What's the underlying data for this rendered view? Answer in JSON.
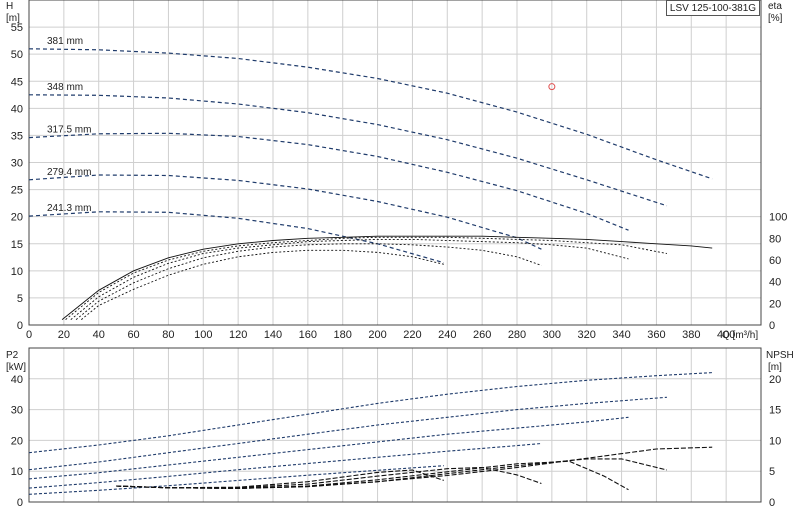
{
  "colors": {
    "curve_dark": "#1f3b6b",
    "curve_black": "#111111",
    "grid": "#cfcfcf",
    "frame": "#444444",
    "point": "#e05050"
  },
  "title": "LSV 125-100-381G",
  "chart_data": [
    {
      "type": "line",
      "name": "head",
      "ylabel_left_top": "H",
      "ylabel_left_unit": "[m]",
      "ylabel_right_top": "eta",
      "ylabel_right_unit": "[%]",
      "xlabel": "Q [m³/h]",
      "xlim": [
        0,
        420
      ],
      "ylim": [
        0,
        60
      ],
      "xticks": [
        0,
        20,
        40,
        60,
        80,
        100,
        120,
        140,
        160,
        180,
        200,
        220,
        240,
        260,
        280,
        300,
        320,
        340,
        360,
        380,
        400
      ],
      "yticks": [
        0,
        5,
        10,
        15,
        20,
        25,
        30,
        35,
        40,
        45,
        50,
        55
      ],
      "eta_ticks": [
        0,
        20,
        40,
        60,
        80,
        100
      ],
      "series": [
        {
          "name": "381 mm",
          "x": [
            0,
            40,
            80,
            120,
            160,
            200,
            240,
            280,
            320,
            360,
            392
          ],
          "y": [
            51,
            50.8,
            50.2,
            49.2,
            47.6,
            45.5,
            42.8,
            39.3,
            35.2,
            30.5,
            27
          ]
        },
        {
          "name": "348 mm",
          "x": [
            0,
            40,
            80,
            120,
            160,
            200,
            240,
            280,
            320,
            366
          ],
          "y": [
            42.5,
            42.4,
            41.9,
            40.8,
            39.2,
            37.0,
            34.2,
            30.8,
            26.8,
            22
          ]
        },
        {
          "name": "317.5 mm",
          "x": [
            0,
            40,
            80,
            120,
            160,
            200,
            240,
            280,
            320,
            344
          ],
          "y": [
            34.6,
            35.3,
            35.4,
            34.8,
            33.3,
            31.1,
            28.2,
            24.8,
            20.6,
            17.5
          ]
        },
        {
          "name": "279.4 mm",
          "x": [
            0,
            40,
            80,
            120,
            160,
            200,
            240,
            280,
            294
          ],
          "y": [
            26.8,
            27.7,
            27.6,
            26.7,
            25.1,
            22.8,
            19.9,
            16.1,
            14
          ]
        },
        {
          "name": "241.3 mm",
          "x": [
            0,
            40,
            80,
            120,
            160,
            200,
            238
          ],
          "y": [
            20.1,
            20.9,
            20.8,
            19.7,
            17.8,
            15.0,
            11.5
          ]
        }
      ],
      "eta_series": [
        {
          "x": [
            19,
            40,
            60,
            80,
            100,
            120,
            140,
            160,
            180,
            200,
            220,
            240,
            260,
            280,
            300,
            320,
            340,
            360,
            380,
            392
          ],
          "y": [
            5,
            32,
            50,
            62,
            70,
            75,
            78,
            80,
            81,
            82,
            82,
            82,
            82,
            81,
            80,
            79,
            77,
            75,
            73,
            71
          ]
        },
        {
          "x": [
            21,
            40,
            60,
            80,
            100,
            120,
            140,
            160,
            180,
            200,
            220,
            240,
            260,
            280,
            300,
            320,
            340,
            366
          ],
          "y": [
            5,
            30,
            48,
            60,
            68,
            73,
            76,
            78,
            80,
            81,
            81,
            81,
            80,
            79,
            78,
            76,
            74,
            66
          ]
        },
        {
          "x": [
            24,
            40,
            60,
            80,
            100,
            120,
            140,
            160,
            180,
            200,
            220,
            240,
            260,
            280,
            300,
            320,
            344
          ],
          "y": [
            5,
            26,
            44,
            57,
            66,
            71,
            74,
            77,
            78,
            79,
            79,
            78,
            77,
            76,
            74,
            71,
            61
          ]
        },
        {
          "x": [
            27,
            40,
            60,
            80,
            100,
            120,
            140,
            160,
            180,
            200,
            220,
            240,
            260,
            280,
            294
          ],
          "y": [
            5,
            22,
            39,
            52,
            62,
            68,
            72,
            74,
            75,
            75,
            74,
            72,
            69,
            63,
            55
          ]
        },
        {
          "x": [
            30,
            40,
            60,
            80,
            100,
            120,
            140,
            160,
            180,
            200,
            220,
            238
          ],
          "y": [
            5,
            18,
            33,
            46,
            56,
            63,
            67,
            69,
            69,
            67,
            63,
            56
          ]
        }
      ],
      "duty_point": {
        "x": 300,
        "y": 44
      }
    },
    {
      "type": "line",
      "name": "power_npsh",
      "ylabel_left_top": "P2",
      "ylabel_left_unit": "[kW]",
      "ylabel_right_top": "NPSH",
      "ylabel_right_unit": "[m]",
      "xlim": [
        0,
        420
      ],
      "ylim": [
        0,
        50
      ],
      "yticks": [
        0,
        10,
        20,
        30,
        40
      ],
      "npsh_ticks": [
        0,
        5,
        10,
        15,
        20
      ],
      "p2_series": [
        {
          "x": [
            0,
            40,
            80,
            120,
            160,
            200,
            240,
            280,
            320,
            360,
            392
          ],
          "y": [
            16,
            18.5,
            21.5,
            25,
            28.5,
            32,
            35,
            37.5,
            39.5,
            41,
            42
          ]
        },
        {
          "x": [
            0,
            40,
            80,
            120,
            160,
            200,
            240,
            280,
            320,
            366
          ],
          "y": [
            10.5,
            13,
            16,
            19,
            22,
            25,
            27.5,
            30,
            32,
            34
          ]
        },
        {
          "x": [
            0,
            40,
            80,
            120,
            160,
            200,
            240,
            280,
            320,
            344
          ],
          "y": [
            7.5,
            9.5,
            12,
            14.5,
            17,
            19.5,
            22,
            24,
            26,
            27.5
          ]
        },
        {
          "x": [
            0,
            40,
            80,
            120,
            160,
            200,
            240,
            280,
            294
          ],
          "y": [
            4.5,
            6.3,
            8.3,
            10.5,
            12.5,
            14.5,
            16.5,
            18.3,
            19
          ]
        },
        {
          "x": [
            0,
            40,
            80,
            120,
            160,
            200,
            238
          ],
          "y": [
            2.5,
            3.8,
            5.3,
            7,
            8.7,
            10.3,
            11.8
          ]
        }
      ],
      "npsh_series": [
        {
          "x": [
            50,
            80,
            120,
            160,
            200,
            240,
            280,
            320,
            360,
            392
          ],
          "y": [
            2.6,
            2.3,
            2.2,
            2.5,
            3.3,
            4.3,
            5.6,
            7.1,
            8.6,
            8.9
          ]
        },
        {
          "x": [
            50,
            80,
            120,
            160,
            200,
            240,
            280,
            320,
            340,
            366
          ],
          "y": [
            2.6,
            2.3,
            2.2,
            2.5,
            3.3,
            4.6,
            5.9,
            7.0,
            7.0,
            5.2
          ]
        },
        {
          "x": [
            50,
            80,
            120,
            160,
            200,
            240,
            280,
            310,
            330,
            344
          ],
          "y": [
            2.6,
            2.3,
            2.2,
            2.6,
            3.6,
            4.9,
            6.2,
            6.6,
            4.2,
            2.0
          ]
        },
        {
          "x": [
            50,
            80,
            120,
            160,
            200,
            240,
            260,
            280,
            294
          ],
          "y": [
            2.6,
            2.3,
            2.3,
            2.9,
            4.2,
            5.4,
            5.6,
            4.4,
            3.0
          ]
        },
        {
          "x": [
            50,
            80,
            120,
            160,
            200,
            220,
            238
          ],
          "y": [
            2.6,
            2.3,
            2.4,
            3.3,
            4.8,
            5.2,
            3.5
          ]
        }
      ]
    }
  ]
}
